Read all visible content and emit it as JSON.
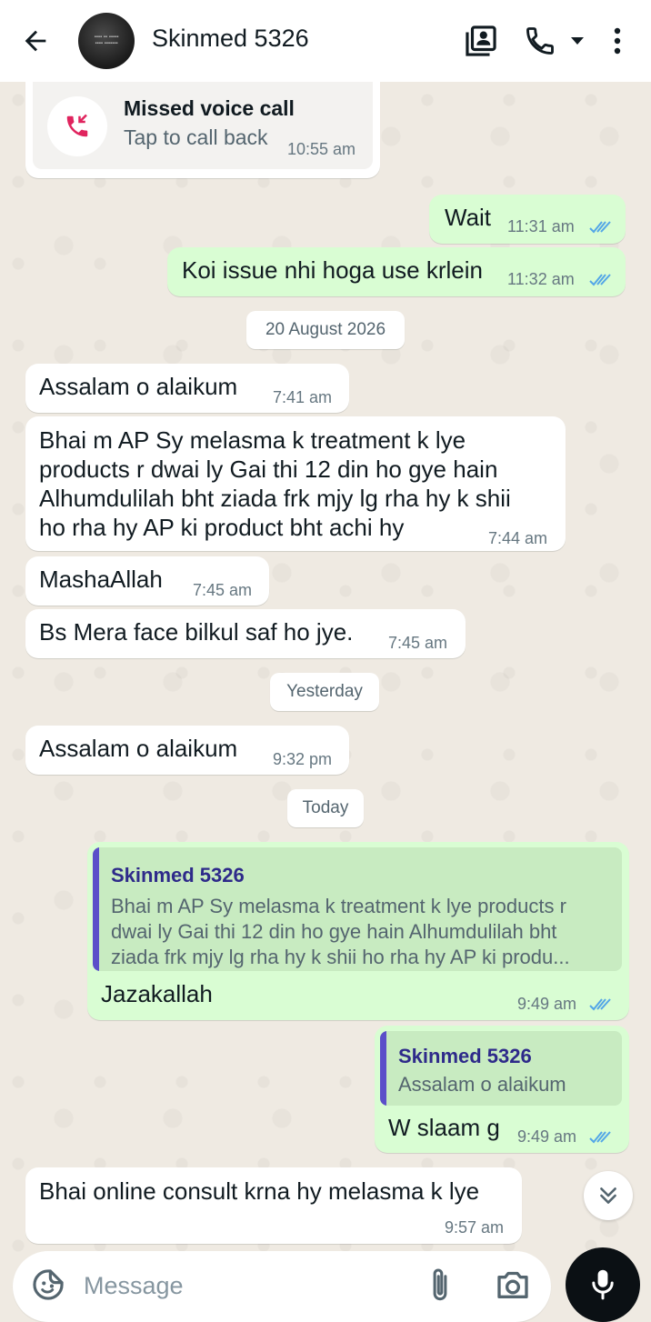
{
  "header": {
    "contact_name": "Skinmed 5326",
    "icons": [
      "back-arrow-icon",
      "avatar",
      "video-call-icon",
      "phone-icon",
      "dropdown-caret-icon",
      "more-vert-icon"
    ]
  },
  "missed_call": {
    "title": "Missed voice call",
    "subtitle": "Tap to call back",
    "time": "10:55 am",
    "icon": "missed-call-icon",
    "icon_color": "#e0245e"
  },
  "messages": [
    {
      "dir": "out",
      "text": "Wait",
      "time": "11:31 am"
    },
    {
      "dir": "out",
      "text": "Koi issue nhi hoga use krlein",
      "time": "11:32 am"
    },
    {
      "dir": "in",
      "text": "Assalam o alaikum",
      "time": "7:41 am"
    },
    {
      "dir": "in",
      "lines": [
        "Bhai m AP Sy melasma k treatment k lye",
        "products r dwai ly Gai thi 12 din ho gye hain",
        "Alhumdulilah bht ziada frk mjy lg rha hy k shii",
        "ho rha hy AP ki product bht achi hy"
      ],
      "time": "7:44 am"
    },
    {
      "dir": "in",
      "text": "MashaAllah",
      "time": "7:45 am"
    },
    {
      "dir": "in",
      "text": "Bs Mera face bilkul saf ho jye.",
      "time": "7:45 am"
    },
    {
      "dir": "in",
      "text": "Assalam o alaikum",
      "time": "9:32 pm"
    },
    {
      "dir": "out",
      "quote_name": "Skinmed 5326",
      "quote_lines": [
        "Bhai m AP Sy melasma k treatment k lye products r",
        "dwai ly Gai thi 12 din ho gye hain Alhumdulilah bht",
        "ziada frk mjy lg rha hy k shii ho rha hy AP ki produ..."
      ],
      "text": "Jazakallah",
      "time": "9:49 am"
    },
    {
      "dir": "out",
      "quote_name": "Skinmed 5326",
      "quote_lines": [
        "Assalam o alaikum"
      ],
      "text": "W slaam g",
      "time": "9:49 am"
    },
    {
      "dir": "in",
      "text": "Bhai online consult krna hy  melasma k lye",
      "time": "9:57 am"
    }
  ],
  "dates": [
    "20 August 2026",
    "Yesterday",
    "Today"
  ],
  "composer": {
    "placeholder": "Message",
    "icons": [
      "sticker-icon",
      "attach-icon",
      "camera-icon",
      "mic-icon"
    ]
  },
  "scroll_icon": "double-chevron-down-icon",
  "colors": {
    "outgoing_bubble": "#d9fdd3",
    "incoming_bubble": "#ffffff",
    "wallpaper": "#efeae2",
    "read_ticks": "#53a6e7",
    "quote_bar": "#5b4fc9"
  }
}
